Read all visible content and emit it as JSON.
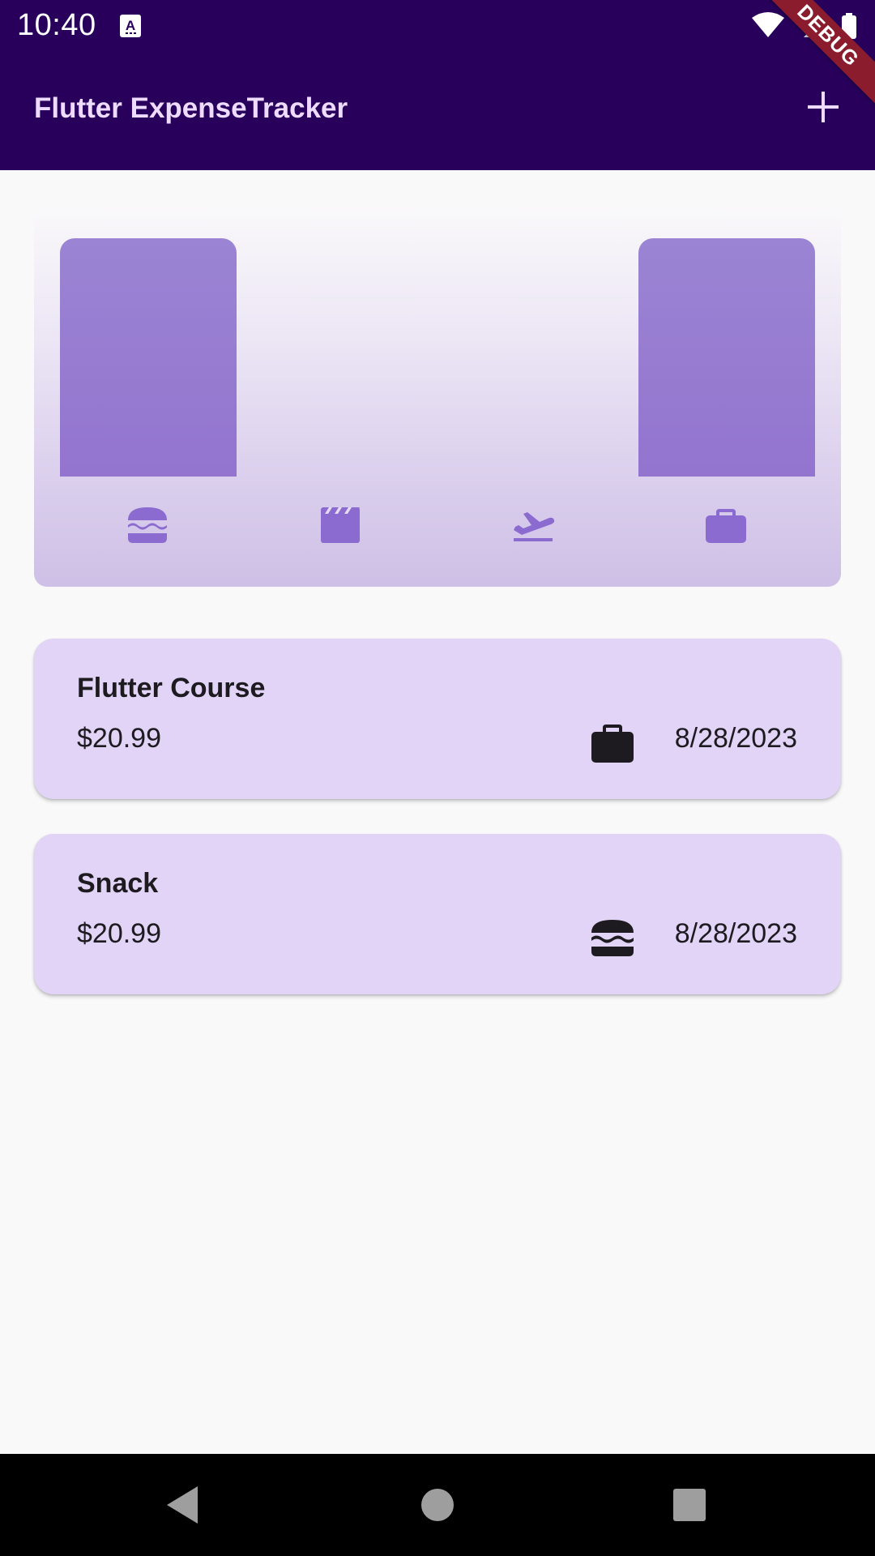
{
  "status_bar": {
    "time": "10:40",
    "icons": [
      "text-a-icon",
      "wifi-icon",
      "signal-icon",
      "battery-icon"
    ]
  },
  "app_bar": {
    "title": "Flutter ExpenseTracker",
    "add_icon": "plus-icon"
  },
  "debug_banner": {
    "label": "DEBUG"
  },
  "chart": {
    "categories": [
      "food",
      "leisure",
      "travel",
      "work"
    ],
    "category_icons": [
      "burger-icon",
      "clapperboard-icon",
      "flight-takeoff-icon",
      "briefcase-icon"
    ],
    "bucket_fill": [
      1.0,
      0.0,
      0.0,
      1.0
    ],
    "bar_color": "#977cd2",
    "icon_color": "#8c6bd0"
  },
  "chart_data": {
    "type": "bar",
    "categories": [
      "food",
      "leisure",
      "travel",
      "work"
    ],
    "values": [
      20.99,
      0,
      0,
      20.99
    ]
  },
  "expenses": [
    {
      "title": "Flutter Course",
      "amount": "$20.99",
      "category_icon": "briefcase-icon",
      "date": "8/28/2023"
    },
    {
      "title": "Snack",
      "amount": "$20.99",
      "category_icon": "burger-icon",
      "date": "8/28/2023"
    }
  ],
  "nav_bar": {
    "buttons": [
      "back-icon",
      "home-icon",
      "recents-icon"
    ]
  },
  "colors": {
    "app_bar": "#28005c",
    "title_text": "#eddcff",
    "card_bg": "#e1d4f6",
    "background": "#faf9fa"
  }
}
